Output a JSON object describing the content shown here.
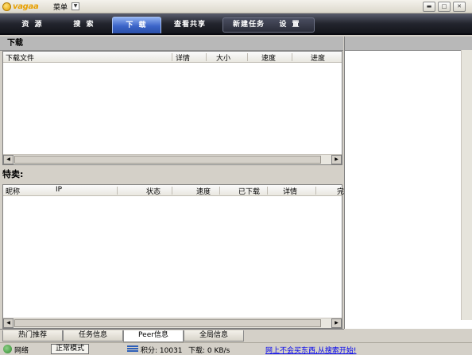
{
  "titlebar": {
    "logo_text": "vagaa",
    "menu_label": "菜单"
  },
  "nav": {
    "tabs": [
      {
        "label": "资 源"
      },
      {
        "label": "搜 索"
      },
      {
        "label": "下 载"
      },
      {
        "label": "查看共享"
      },
      {
        "label": "新建任务"
      },
      {
        "label": "设 置"
      }
    ],
    "active_index": 2
  },
  "downloads": {
    "section_title": "下载",
    "columns": [
      "下载文件",
      "详情",
      "大小",
      "速度",
      "进度"
    ]
  },
  "promo": {
    "title": "特卖:",
    "columns": [
      "昵称",
      "IP",
      "状态",
      "速度",
      "已下载",
      "详情",
      "完"
    ]
  },
  "bottom_tabs": [
    "热门推荐",
    "任务信息",
    "Peer信息",
    "全局信息"
  ],
  "bottom_active_index": 2,
  "statusbar": {
    "network_label": "网络",
    "mode_label": "正常模式",
    "score_text": "积分: 10031",
    "download_speed": "下载: 0 KB/s",
    "ad_link": "网上不会买东西,从搜索开始!"
  },
  "colors": {
    "nav_active": "#3b64c8",
    "nav_bg": "#23252e",
    "link": "#0000ee"
  }
}
